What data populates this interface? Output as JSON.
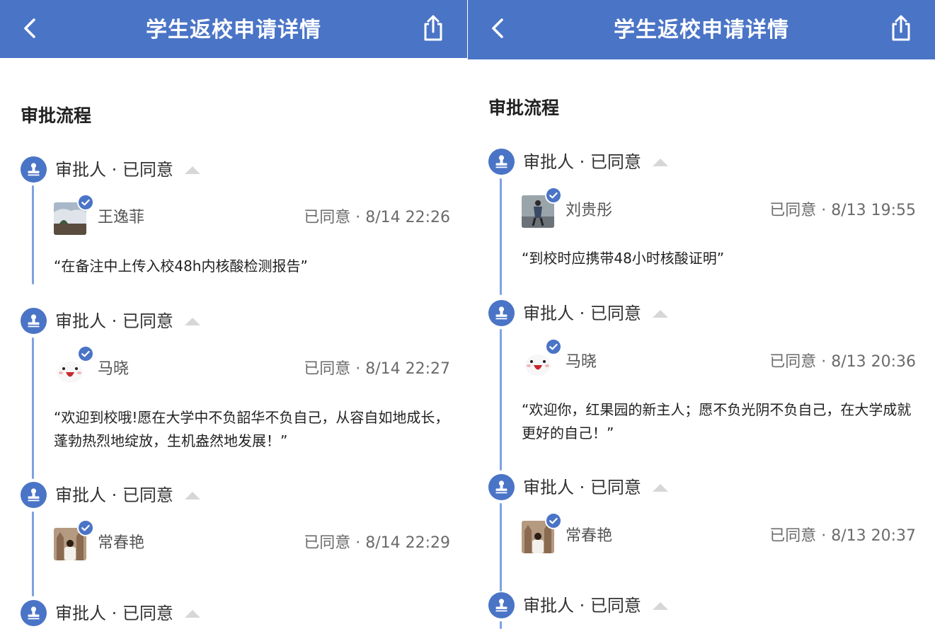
{
  "left": {
    "header": {
      "title": "学生返校申请详情"
    },
    "section_title": "审批流程",
    "steps": [
      {
        "label": "审批人 · 已同意",
        "name": "王逸菲",
        "status": "已同意 · 8/14 22:26",
        "comment": "“在备注中上传入校48h内核酸检测报告”"
      },
      {
        "label": "审批人 · 已同意",
        "name": "马晓",
        "status": "已同意 · 8/14 22:27",
        "comment": "“欢迎到校哦!愿在大学中不负韶华不负自己，从容自如地成长，蓬勃热烈地绽放，生机盎然地发展！”"
      },
      {
        "label": "审批人 · 已同意",
        "name": "常春艳",
        "status": "已同意 · 8/14 22:29"
      },
      {
        "label": "审批人 · 已同意"
      }
    ]
  },
  "right": {
    "header": {
      "title": "学生返校申请详情"
    },
    "section_title": "审批流程",
    "steps": [
      {
        "label": "审批人 · 已同意",
        "name": "刘贵彤",
        "status": "已同意 · 8/13 19:55",
        "comment": "“到校时应携带48小时核酸证明”"
      },
      {
        "label": "审批人 · 已同意",
        "name": "马晓",
        "status": "已同意 · 8/13 20:36",
        "comment": "“欢迎你，红果园的新主人；愿不负光阴不负自己，在大学成就更好的自己！”"
      },
      {
        "label": "审批人 · 已同意",
        "name": "常春艳",
        "status": "已同意 · 8/13 20:37"
      },
      {
        "label": "审批人 · 已同意"
      }
    ]
  },
  "icons": {
    "back": "chevron-left-icon",
    "share": "share-icon",
    "step": "stamp-icon",
    "collapse": "triangle-up-icon",
    "verified": "check-badge-icon"
  },
  "colors": {
    "brand": "#4a74c6",
    "timeline": "#7ea2e0"
  }
}
